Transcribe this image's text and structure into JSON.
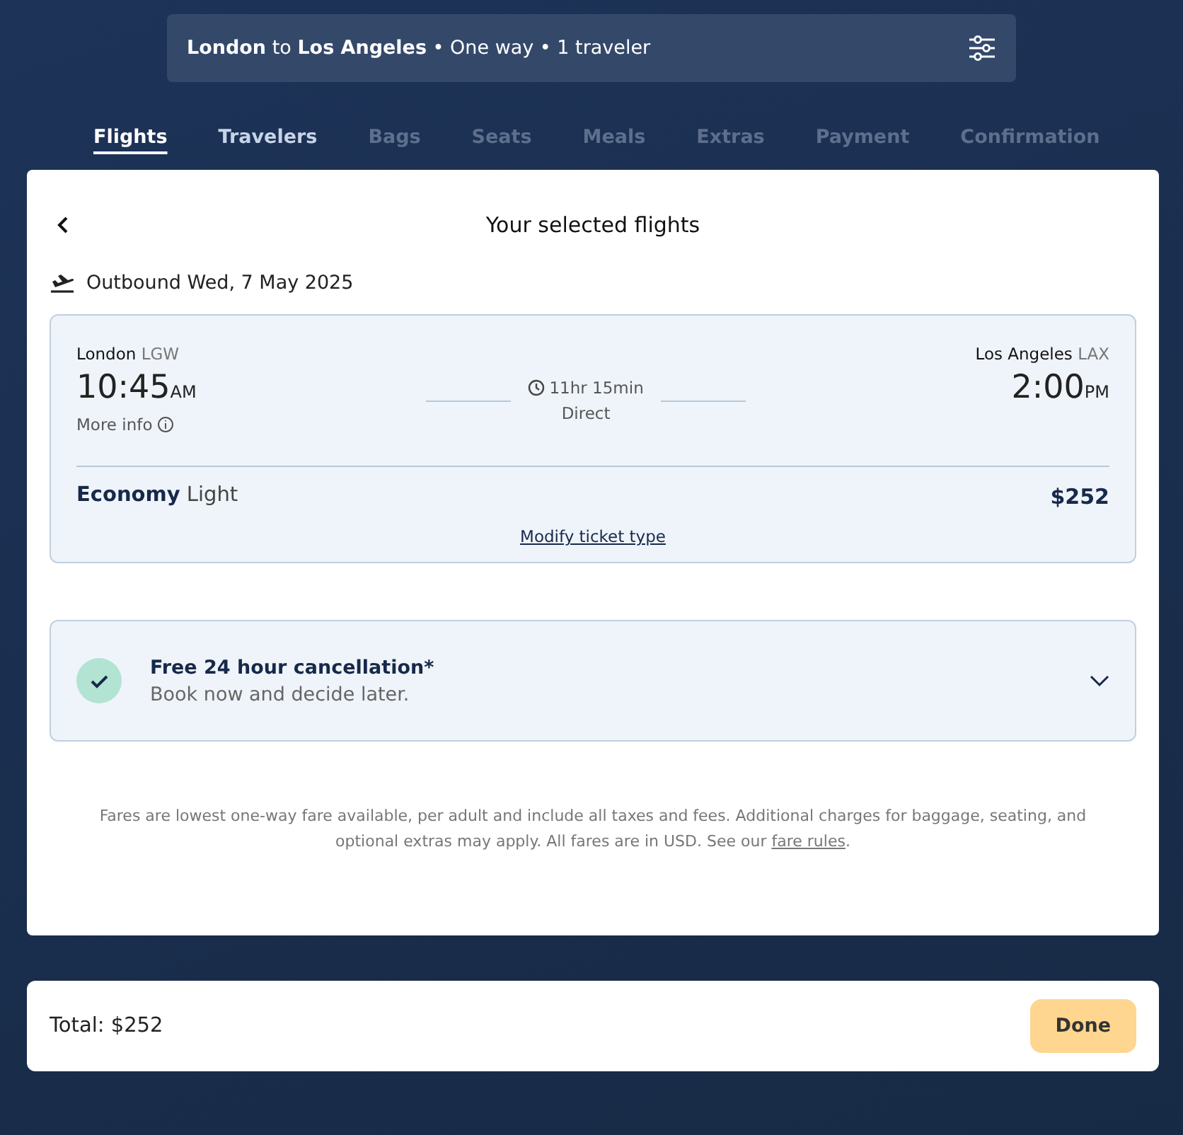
{
  "search_summary": {
    "text": "**London** to **Los Angeles** • One way • 1 traveler"
  },
  "tabs": [
    {
      "label": "Flights",
      "selected": true,
      "disabled": false
    },
    {
      "label": "Travelers",
      "selected": false,
      "disabled": false
    },
    {
      "label": "Bags",
      "selected": false,
      "disabled": true
    },
    {
      "label": "Seats",
      "selected": false,
      "disabled": true
    },
    {
      "label": "Meals",
      "selected": false,
      "disabled": true
    },
    {
      "label": "Extras",
      "selected": false,
      "disabled": true
    },
    {
      "label": "Payment",
      "selected": false,
      "disabled": true
    },
    {
      "label": "Confirmation",
      "selected": false,
      "disabled": true
    }
  ],
  "panel": {
    "title": "Your selected flights",
    "outbound": "Outbound Wed, 7 May 2025",
    "flight": {
      "origin_city": "London",
      "origin_code": "LGW",
      "depart_time": "10:45",
      "depart_ampm": "AM",
      "more_info": "More info",
      "duration": "11hr 15min",
      "stops": "Direct",
      "dest_city": "Los Angeles",
      "dest_code": "LAX",
      "arrive_time": "2:00",
      "arrive_ampm": "PM",
      "cabin": "Economy",
      "fare": "Light",
      "price": "$252",
      "modify_link": "Modify ticket type"
    },
    "cancellation": {
      "title": "Free 24 hour cancellation*",
      "subtitle": "Book now and decide later.",
      "expanded": false
    },
    "disclaimer": "Fares are lowest one-way fare available, per adult and include all taxes and fees. Additional charges for baggage, seating, and optional extras may apply. All fares are in USD. See our",
    "disclaimer_link": "fare rules",
    "disclaimer_end": "."
  },
  "footer": {
    "total": "Total: $252",
    "button": "Done"
  }
}
